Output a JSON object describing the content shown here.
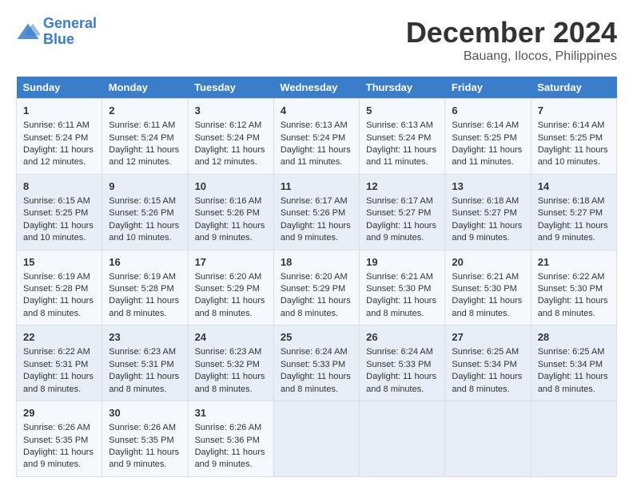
{
  "header": {
    "logo_line1": "General",
    "logo_line2": "Blue",
    "title": "December 2024",
    "subtitle": "Bauang, Ilocos, Philippines"
  },
  "weekdays": [
    "Sunday",
    "Monday",
    "Tuesday",
    "Wednesday",
    "Thursday",
    "Friday",
    "Saturday"
  ],
  "weeks": [
    [
      {
        "day": "1",
        "lines": [
          "Sunrise: 6:11 AM",
          "Sunset: 5:24 PM",
          "Daylight: 11 hours",
          "and 12 minutes."
        ]
      },
      {
        "day": "2",
        "lines": [
          "Sunrise: 6:11 AM",
          "Sunset: 5:24 PM",
          "Daylight: 11 hours",
          "and 12 minutes."
        ]
      },
      {
        "day": "3",
        "lines": [
          "Sunrise: 6:12 AM",
          "Sunset: 5:24 PM",
          "Daylight: 11 hours",
          "and 12 minutes."
        ]
      },
      {
        "day": "4",
        "lines": [
          "Sunrise: 6:13 AM",
          "Sunset: 5:24 PM",
          "Daylight: 11 hours",
          "and 11 minutes."
        ]
      },
      {
        "day": "5",
        "lines": [
          "Sunrise: 6:13 AM",
          "Sunset: 5:24 PM",
          "Daylight: 11 hours",
          "and 11 minutes."
        ]
      },
      {
        "day": "6",
        "lines": [
          "Sunrise: 6:14 AM",
          "Sunset: 5:25 PM",
          "Daylight: 11 hours",
          "and 11 minutes."
        ]
      },
      {
        "day": "7",
        "lines": [
          "Sunrise: 6:14 AM",
          "Sunset: 5:25 PM",
          "Daylight: 11 hours",
          "and 10 minutes."
        ]
      }
    ],
    [
      {
        "day": "8",
        "lines": [
          "Sunrise: 6:15 AM",
          "Sunset: 5:25 PM",
          "Daylight: 11 hours",
          "and 10 minutes."
        ]
      },
      {
        "day": "9",
        "lines": [
          "Sunrise: 6:15 AM",
          "Sunset: 5:26 PM",
          "Daylight: 11 hours",
          "and 10 minutes."
        ]
      },
      {
        "day": "10",
        "lines": [
          "Sunrise: 6:16 AM",
          "Sunset: 5:26 PM",
          "Daylight: 11 hours",
          "and 9 minutes."
        ]
      },
      {
        "day": "11",
        "lines": [
          "Sunrise: 6:17 AM",
          "Sunset: 5:26 PM",
          "Daylight: 11 hours",
          "and 9 minutes."
        ]
      },
      {
        "day": "12",
        "lines": [
          "Sunrise: 6:17 AM",
          "Sunset: 5:27 PM",
          "Daylight: 11 hours",
          "and 9 minutes."
        ]
      },
      {
        "day": "13",
        "lines": [
          "Sunrise: 6:18 AM",
          "Sunset: 5:27 PM",
          "Daylight: 11 hours",
          "and 9 minutes."
        ]
      },
      {
        "day": "14",
        "lines": [
          "Sunrise: 6:18 AM",
          "Sunset: 5:27 PM",
          "Daylight: 11 hours",
          "and 9 minutes."
        ]
      }
    ],
    [
      {
        "day": "15",
        "lines": [
          "Sunrise: 6:19 AM",
          "Sunset: 5:28 PM",
          "Daylight: 11 hours",
          "and 8 minutes."
        ]
      },
      {
        "day": "16",
        "lines": [
          "Sunrise: 6:19 AM",
          "Sunset: 5:28 PM",
          "Daylight: 11 hours",
          "and 8 minutes."
        ]
      },
      {
        "day": "17",
        "lines": [
          "Sunrise: 6:20 AM",
          "Sunset: 5:29 PM",
          "Daylight: 11 hours",
          "and 8 minutes."
        ]
      },
      {
        "day": "18",
        "lines": [
          "Sunrise: 6:20 AM",
          "Sunset: 5:29 PM",
          "Daylight: 11 hours",
          "and 8 minutes."
        ]
      },
      {
        "day": "19",
        "lines": [
          "Sunrise: 6:21 AM",
          "Sunset: 5:30 PM",
          "Daylight: 11 hours",
          "and 8 minutes."
        ]
      },
      {
        "day": "20",
        "lines": [
          "Sunrise: 6:21 AM",
          "Sunset: 5:30 PM",
          "Daylight: 11 hours",
          "and 8 minutes."
        ]
      },
      {
        "day": "21",
        "lines": [
          "Sunrise: 6:22 AM",
          "Sunset: 5:30 PM",
          "Daylight: 11 hours",
          "and 8 minutes."
        ]
      }
    ],
    [
      {
        "day": "22",
        "lines": [
          "Sunrise: 6:22 AM",
          "Sunset: 5:31 PM",
          "Daylight: 11 hours",
          "and 8 minutes."
        ]
      },
      {
        "day": "23",
        "lines": [
          "Sunrise: 6:23 AM",
          "Sunset: 5:31 PM",
          "Daylight: 11 hours",
          "and 8 minutes."
        ]
      },
      {
        "day": "24",
        "lines": [
          "Sunrise: 6:23 AM",
          "Sunset: 5:32 PM",
          "Daylight: 11 hours",
          "and 8 minutes."
        ]
      },
      {
        "day": "25",
        "lines": [
          "Sunrise: 6:24 AM",
          "Sunset: 5:33 PM",
          "Daylight: 11 hours",
          "and 8 minutes."
        ]
      },
      {
        "day": "26",
        "lines": [
          "Sunrise: 6:24 AM",
          "Sunset: 5:33 PM",
          "Daylight: 11 hours",
          "and 8 minutes."
        ]
      },
      {
        "day": "27",
        "lines": [
          "Sunrise: 6:25 AM",
          "Sunset: 5:34 PM",
          "Daylight: 11 hours",
          "and 8 minutes."
        ]
      },
      {
        "day": "28",
        "lines": [
          "Sunrise: 6:25 AM",
          "Sunset: 5:34 PM",
          "Daylight: 11 hours",
          "and 8 minutes."
        ]
      }
    ],
    [
      {
        "day": "29",
        "lines": [
          "Sunrise: 6:26 AM",
          "Sunset: 5:35 PM",
          "Daylight: 11 hours",
          "and 9 minutes."
        ]
      },
      {
        "day": "30",
        "lines": [
          "Sunrise: 6:26 AM",
          "Sunset: 5:35 PM",
          "Daylight: 11 hours",
          "and 9 minutes."
        ]
      },
      {
        "day": "31",
        "lines": [
          "Sunrise: 6:26 AM",
          "Sunset: 5:36 PM",
          "Daylight: 11 hours",
          "and 9 minutes."
        ]
      },
      null,
      null,
      null,
      null
    ]
  ]
}
